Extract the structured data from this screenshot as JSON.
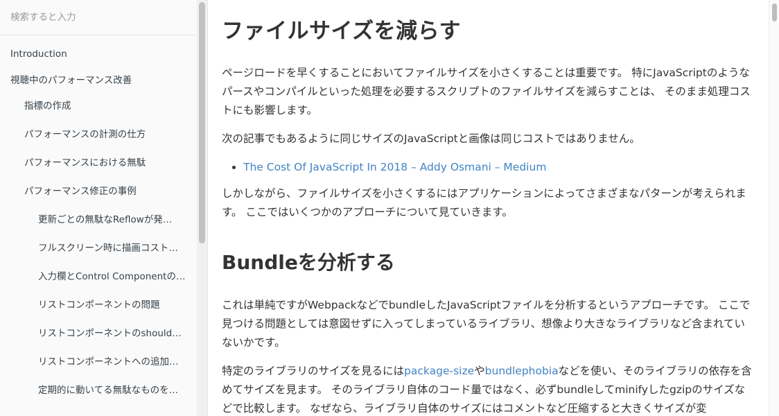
{
  "sidebar": {
    "search_placeholder": "検索すると入力",
    "items": [
      {
        "label": "Introduction"
      },
      {
        "label": "視聴中のパフォーマンス改善"
      },
      {
        "label": "指標の作成"
      },
      {
        "label": "パフォーマンスの計測の仕方"
      },
      {
        "label": "パフォーマンスにおける無駄"
      },
      {
        "label": "パフォーマンス修正の事例"
      },
      {
        "label": "更新ごとの無駄なReflowが発…"
      },
      {
        "label": "フルスクリーン時に描画コスト…"
      },
      {
        "label": "入力欄とControl Componentの…"
      },
      {
        "label": "リストコンポーネントの問題"
      },
      {
        "label": "リストコンポーネントのshould…"
      },
      {
        "label": "リストコンポーネントへの追加…"
      },
      {
        "label": "定期的に動いてる無駄なものを…"
      }
    ]
  },
  "article": {
    "h1": "ファイルサイズを減らす",
    "p1": "ページロードを早くすることにおいてファイルサイズを小さくすることは重要です。 特にJavaScriptのようなパースやコンパイルといった処理を必要するスクリプトのファイルサイズを減らすことは、 そのまま処理コストにも影響します。",
    "p2": "次の記事でもあるように同じサイズのJavaScriptと画像は同じコストではありません。",
    "link1": "The Cost Of JavaScript In 2018 – Addy Osmani – Medium",
    "p3": "しかしながら、ファイルサイズを小さくするにはアプリケーションによってさまざまなパターンが考えられます。 ここではいくつかのアプローチについて見ていきます。",
    "h2": "Bundleを分析する",
    "p4": "これは単純ですがWebpackなどでbundleしたJavaScriptファイルを分析するというアプローチです。 ここで見つける問題としては意図せずに入ってしまっているライブラリ、想像より大きなライブラリなど含まれていないかです。",
    "p5_a": "特定のライブラリのサイズを見るには",
    "p5_link1": "package-size",
    "p5_b": "や",
    "p5_link2": "bundlephobia",
    "p5_c": "などを使い、そのライブラリの依存を含めてサイズを見ます。 そのライブラリ自体のコード量ではなく、必ずbundleしてminifyしたgzipのサイズなどで比較します。 なぜなら、ライブラリ自体のサイズにはコメントなど圧縮すると大きくサイズが変"
  }
}
